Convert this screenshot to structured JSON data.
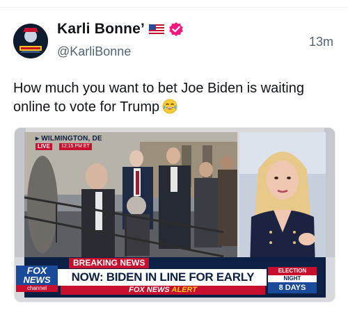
{
  "author": {
    "name": "Karli Bonne’",
    "handle": "@KarliBonne",
    "timestamp": "13m",
    "verified_color": "#f91880",
    "flag_icon": "us-flag-icon"
  },
  "tweet": {
    "text": "How much you want to bet Joe Biden is waiting online to vote for Trump",
    "emoji_icon": "laughing-tears-emoji-icon"
  },
  "media": {
    "location": "▸ WILMINGTON, DE",
    "live_label": "LIVE",
    "live_time": "12:15 PM ET",
    "breaking_label": "BREAKING NEWS",
    "headline": "NOW: BIDEN IN LINE FOR EARLY VOTING",
    "alert_prefix": "FOX NEWS",
    "alert_word": "ALERT",
    "logo_line1": "FOX",
    "logo_line2": "NEWS",
    "logo_line3": "channel",
    "election_label": "ELECTION",
    "night_label": "NIGHT",
    "days_label": "8 DAYS"
  }
}
